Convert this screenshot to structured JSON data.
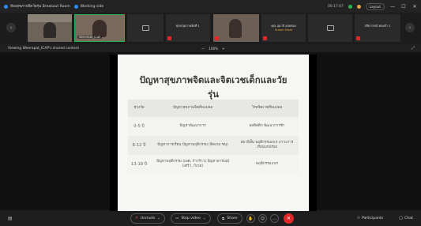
{
  "titlebar": {
    "room": "ห้องสุขภาพจิตวัยรุ่น Breakout Room",
    "recording": "Working side",
    "time": "00:17:07",
    "layout": "Layout",
    "minimize": "—",
    "maximize": "☐",
    "close": "✕"
  },
  "gallery": {
    "prev": "‹",
    "next": "›",
    "tiles": [
      {
        "name": "",
        "center": "",
        "sub": ""
      },
      {
        "name": "Weerapat_ICAP",
        "center": "",
        "sub": ""
      },
      {
        "name": "",
        "center": "",
        "sub": ""
      },
      {
        "name": "",
        "center": "ศุภกฤตภาพจิตที่ 1",
        "sub": ""
      },
      {
        "name": "",
        "center": "",
        "sub": ""
      },
      {
        "name": "",
        "center": "คุณ สุมาลี ลอยทอง",
        "sub": "Screen Share"
      },
      {
        "name": "",
        "center": "",
        "sub": ""
      },
      {
        "name": "",
        "center": "ปรียาภรณ์ ทองคำ 2",
        "sub": ""
      }
    ]
  },
  "viewbar": {
    "label": "Viewing Weerapat_ICAP's shared content",
    "zoom_minus": "—",
    "zoom_value": "100%",
    "zoom_plus": "+",
    "options": "⤢"
  },
  "slide": {
    "title": "ปัญหาสุขภาพจิตและจิตเวชเด็กและวัยรุ่น",
    "headers": [
      "ช่วงวัย",
      "ปัญหาสุขภาพจิตที่พบบ่อย",
      "โรคจิตเวชที่พบบ่อย"
    ],
    "rows": [
      {
        "age": "0-5 ปี",
        "problem": "ปัญหาพัฒนาการ",
        "disorder": "ออทิสติก พัฒนาการช้า"
      },
      {
        "age": "6-12 ปี",
        "problem": "ปัญหาการเรียน ปัญหาพฤติกรรม (ติดเกม ซน)",
        "disorder": "สมาธิสั้น พฤติกรรมเกเร ภาวะการเรียนบกพร่อง"
      },
      {
        "age": "13-18 ปี",
        "problem": "ปัญหาพฤติกรรม (เพศ, ก้าวร้าว) ปัญหาอารมณ์ (เศร้า, กังวล)",
        "disorder": "พฤติกรรมเกเร"
      }
    ]
  },
  "toolbar": {
    "chat_left": "▤",
    "unmute": "Unmute",
    "stop_video": "Stop video",
    "share": "Share",
    "more": "…",
    "end": "✕",
    "participants": "Participants",
    "chat": "Chat"
  }
}
